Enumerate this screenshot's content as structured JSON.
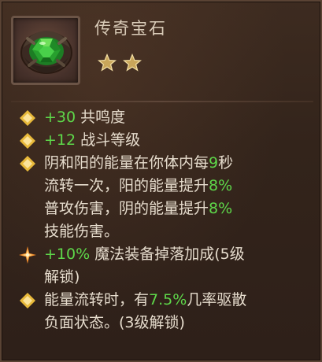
{
  "item": {
    "title": "传奇宝石",
    "icon": "green-gem-icon",
    "star_count": 2,
    "star_color": "#c9a65a"
  },
  "colors": {
    "highlight_green": "#5ed84a",
    "text": "#e6dccd",
    "bullet_gold": "#e8b93a",
    "bullet_orange": "#f08a2a"
  },
  "attributes": [
    {
      "bullet_icon": "gold-diamond-bullet-icon",
      "value": "+30",
      "label": " 共鸣度"
    },
    {
      "bullet_icon": "gold-diamond-bullet-icon",
      "value": "+12",
      "label": " 战斗等级"
    },
    {
      "bullet_icon": "gold-diamond-bullet-icon",
      "l1_a": "阴和阳的能量在你体内每",
      "l1_v": "9",
      "l1_b": "秒",
      "l2_a": "流转一次，阳的能量提升",
      "l2_v": "8%",
      "l3_a": "普攻伤害，阴的能量提升",
      "l3_v": "8%",
      "l4": "技能伤害。"
    },
    {
      "bullet_icon": "orange-sparkle-bullet-icon",
      "value": "+10%",
      "label": " 魔法装备掉落加成(5级",
      "l2": "解锁)"
    },
    {
      "bullet_icon": "gold-diamond-bullet-icon",
      "l1_a": "能量流转时，有",
      "l1_v": "7.5%",
      "l1_b": "几率驱散",
      "l2": "负面状态。(3级解锁)"
    }
  ]
}
